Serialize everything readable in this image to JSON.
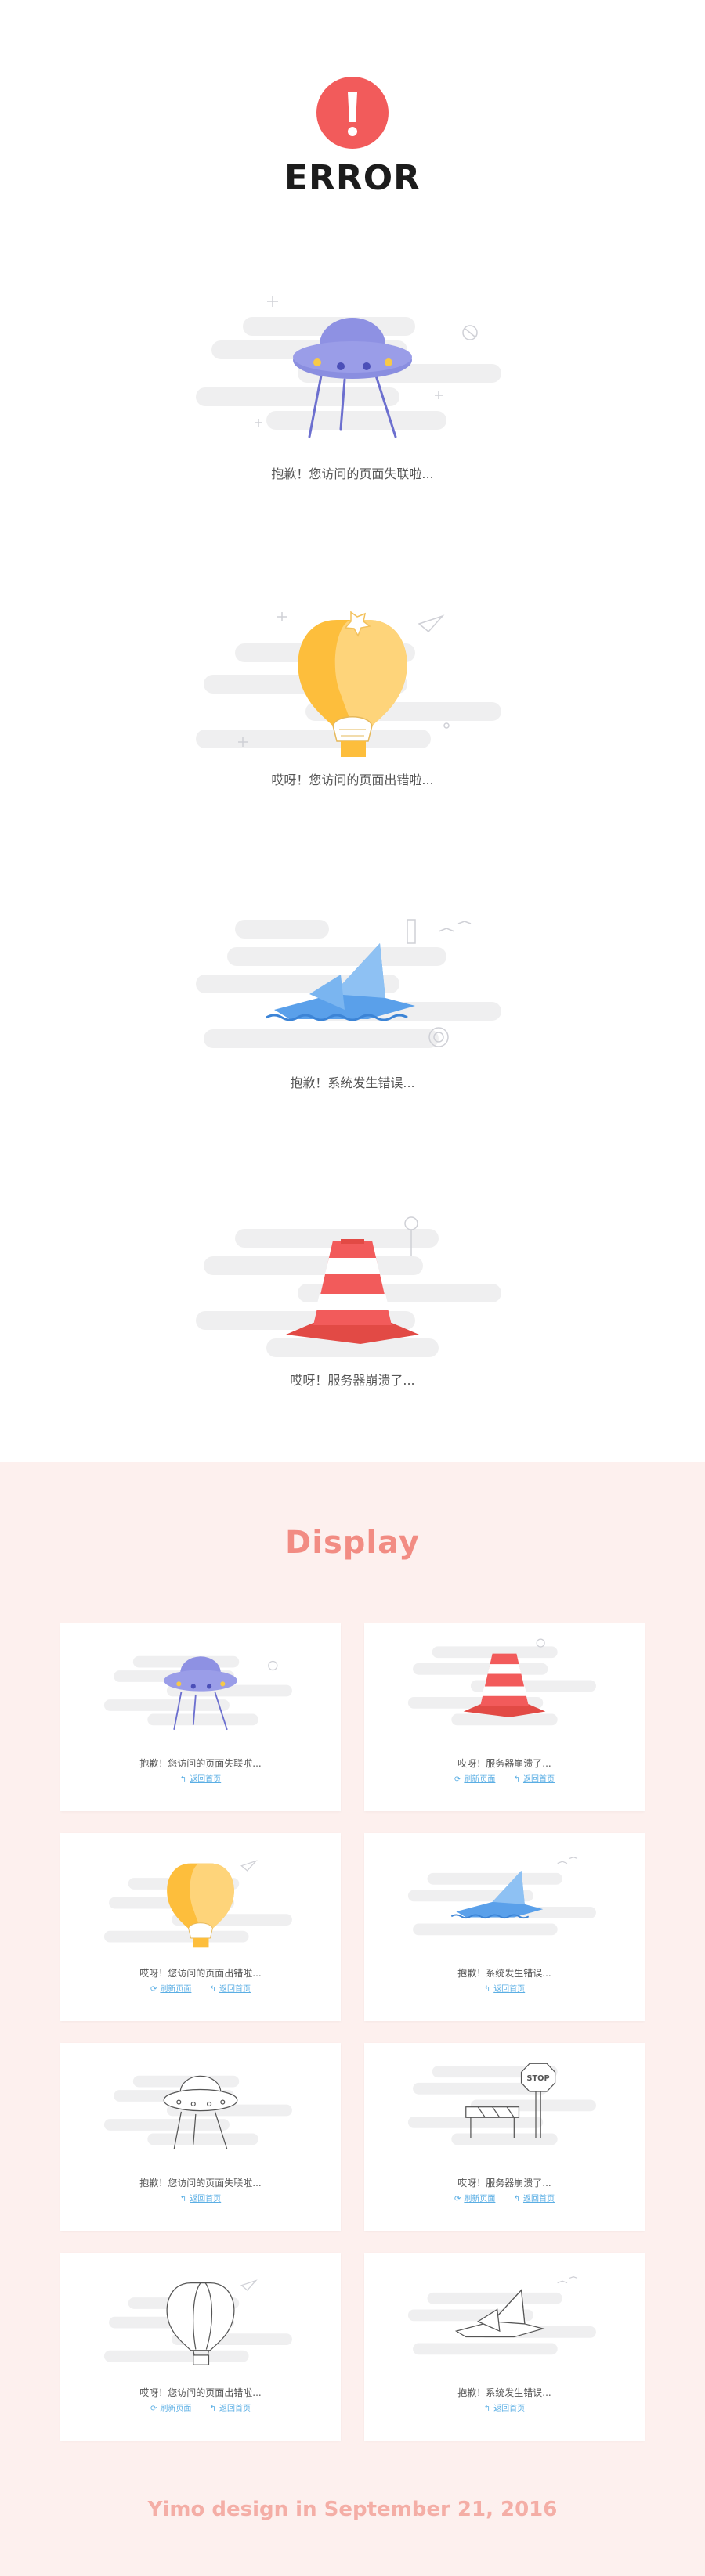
{
  "header": {
    "title": "ERROR"
  },
  "sections": [
    {
      "caption": "抱歉！您访问的页面失联啦..."
    },
    {
      "caption": "哎呀！您访问的页面出错啦..."
    },
    {
      "caption": "抱歉！系统发生错误..."
    },
    {
      "caption": "哎呀！服务器崩溃了..."
    }
  ],
  "display": {
    "title": "Display",
    "cards": [
      {
        "message": "抱歉！您访问的页面失联啦...",
        "links": [
          "返回首页"
        ]
      },
      {
        "message": "哎呀！服务器崩溃了...",
        "links": [
          "刷新页面",
          "返回首页"
        ]
      },
      {
        "message": "哎呀！您访问的页面出错啦...",
        "links": [
          "刷新页面",
          "返回首页"
        ]
      },
      {
        "message": "抱歉！系统发生错误...",
        "links": [
          "返回首页"
        ]
      },
      {
        "message": "抱歉！您访问的页面失联啦...",
        "links": [
          "返回首页"
        ]
      },
      {
        "message": "哎呀！服务器崩溃了...",
        "links": [
          "刷新页面",
          "返回首页"
        ]
      },
      {
        "message": "哎呀！您访问的页面出错啦...",
        "links": [
          "刷新页面",
          "返回首页"
        ]
      },
      {
        "message": "抱歉！系统发生错误...",
        "links": [
          "返回首页"
        ]
      }
    ],
    "stop_sign_text": "STOP"
  },
  "footer": {
    "text": "Yimo design in September 21, 2016"
  },
  "colors": {
    "error_red": "#f25b5b",
    "accent_pink": "#f28c83",
    "link_blue": "#5aaee4",
    "cloud_gray": "#eeeeef"
  }
}
